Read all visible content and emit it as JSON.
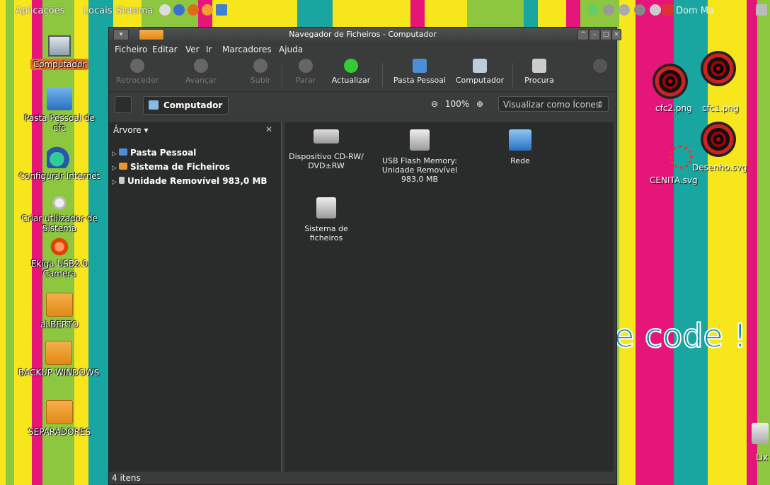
{
  "panel": {
    "menus": [
      "Aplicações",
      "Locais",
      "Sistema"
    ],
    "clock": "Dom Ma"
  },
  "desktop_left": [
    {
      "label": "Computador",
      "icon": "computer-icon"
    },
    {
      "label": "Pasta Pessoal de cfc",
      "icon": "home-folder-icon"
    },
    {
      "label": "Configurar Internet",
      "icon": "network-icon"
    },
    {
      "label": "Criar utilizador de Sistema",
      "icon": "users-icon"
    },
    {
      "label": "Ekiga USB2.0 Camera",
      "icon": "ekiga-icon"
    },
    {
      "label": "aLBERTO",
      "icon": "folder-icon"
    },
    {
      "label": "BACKUP WINDOWS",
      "icon": "folder-icon"
    },
    {
      "label": "SEPARADORES",
      "icon": "folder-icon"
    }
  ],
  "desktop_right": {
    "files": [
      "cfc2.png",
      "cfc1.png",
      "CENITA.svg",
      "Desenho.svg"
    ],
    "trash_label": "Lix",
    "wallpaper_text": "e code !"
  },
  "window": {
    "title": "Navegador de Ficheiros - Computador",
    "menus": [
      "Ficheiro",
      "Editar",
      "Ver",
      "Ir",
      "Marcadores",
      "Ajuda"
    ],
    "toolbar": {
      "back": "Retroceder",
      "forward": "Avançar",
      "up": "Subir",
      "stop": "Parar",
      "reload": "Actualizar",
      "home": "Pasta Pessoal",
      "computer": "Computador",
      "search": "Procura"
    },
    "location": "Computador",
    "zoom": "100%",
    "view_mode": "Visualizar como Ícones",
    "sidebar": {
      "title": "Árvore",
      "items": [
        "Pasta Pessoal",
        "Sistema de Ficheiros",
        "Unidade Removível 983,0 MB"
      ]
    },
    "items": [
      {
        "name": "Dispositivo CD-RW/ DVD±RW",
        "icon": "cd-drive-icon"
      },
      {
        "name": "USB Flash Memory: Unidade Removível 983,0 MB",
        "icon": "usb-drive-icon"
      },
      {
        "name": "Rede",
        "icon": "network-icon"
      },
      {
        "name": "Sistema de ficheiros",
        "icon": "harddisk-icon"
      }
    ],
    "status": "4 itens"
  }
}
